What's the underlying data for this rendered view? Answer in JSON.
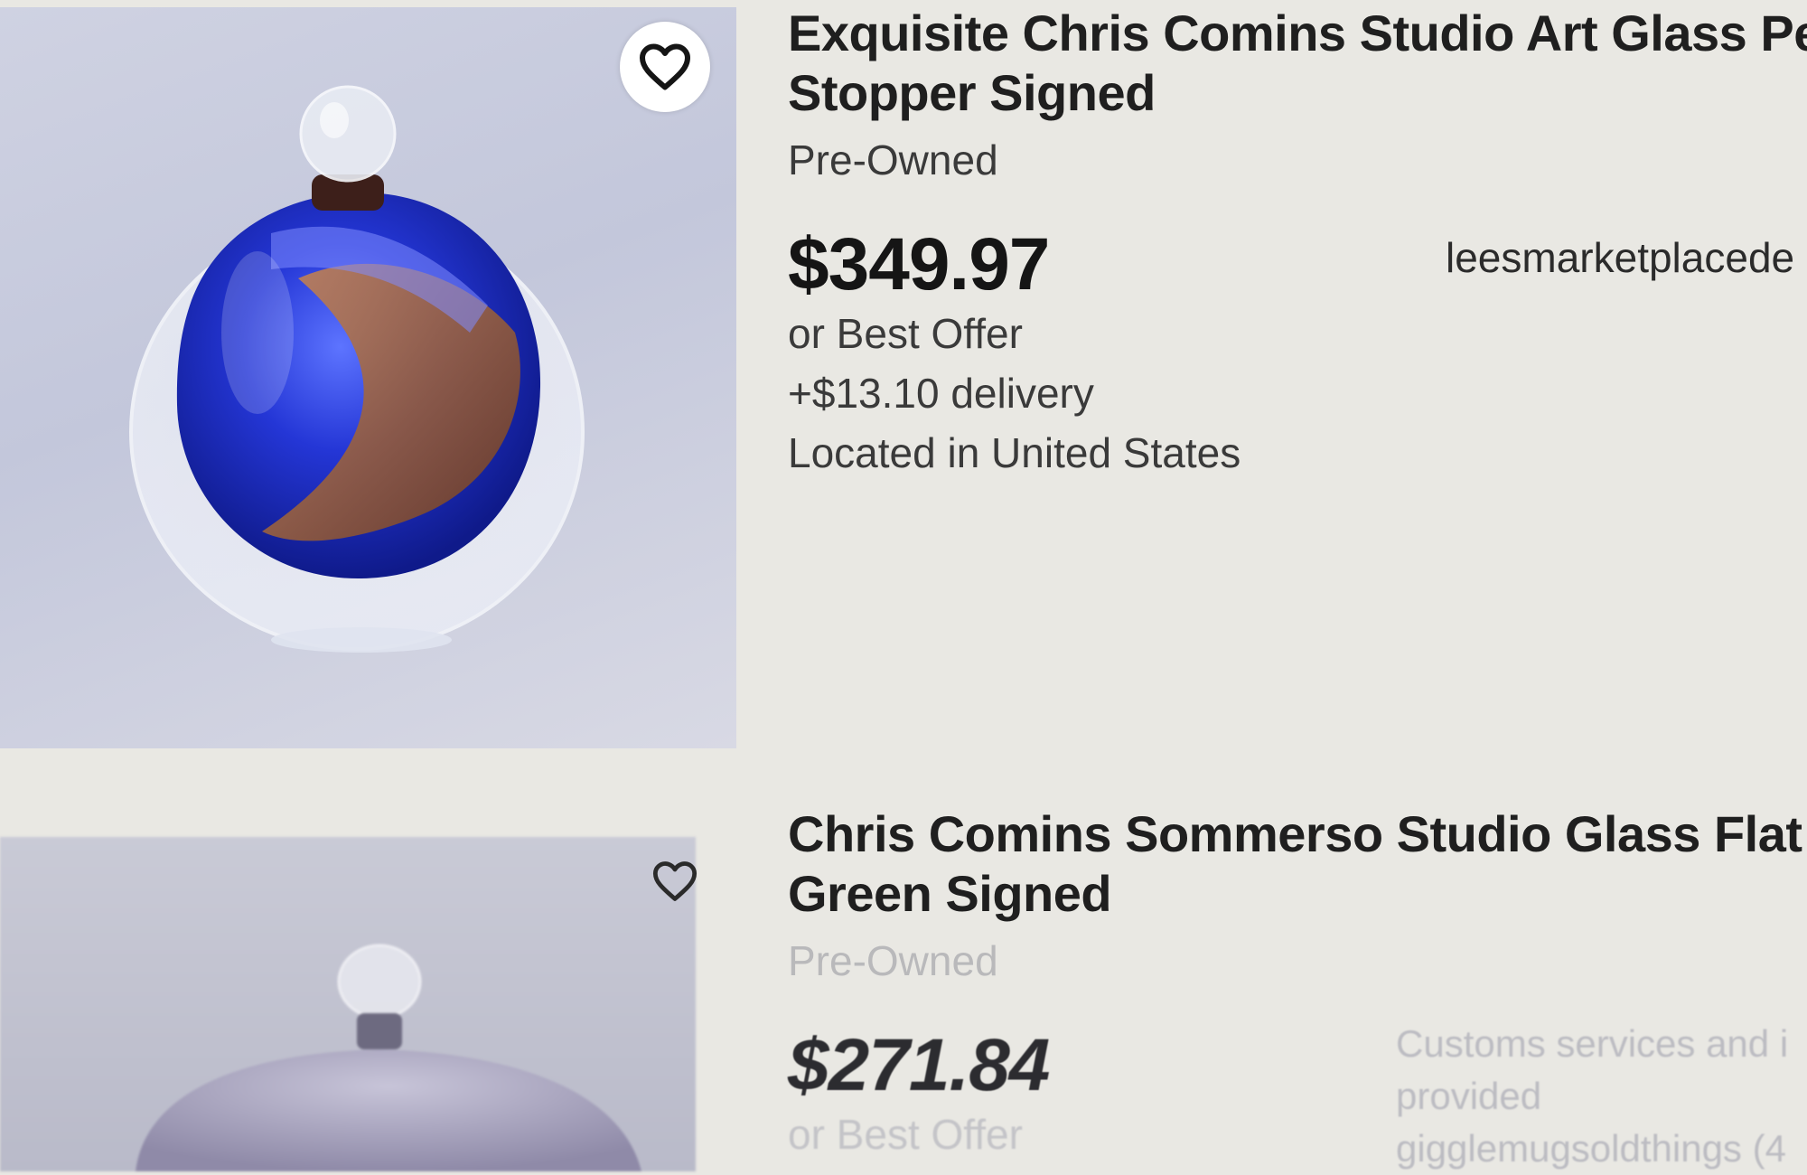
{
  "listings": [
    {
      "title_line1": "Exquisite Chris Comins Studio Art Glass Perfu",
      "title_line2": "Stopper Signed",
      "condition": "Pre-Owned",
      "price": "$349.97",
      "best_offer": "or Best Offer",
      "delivery": "+$13.10 delivery",
      "location": "Located in United States",
      "seller": "leesmarketplacede",
      "watch_icon": "heart-icon"
    },
    {
      "title_line1": "Chris Comins Sommerso Studio Glass Flat Perfu",
      "title_line2": "Green Signed",
      "condition": "Pre-Owned",
      "price": "$271.84",
      "best_offer": "or Best Offer",
      "customs_line1": "Customs services and i",
      "customs_line2": "provided",
      "seller": "gigglemugsoldthings (4",
      "watch_icon": "heart-icon"
    }
  ],
  "colors": {
    "background": "#e9e8e3",
    "bottle_blue": "#1f2fd0",
    "bottle_amber": "#a7683c"
  }
}
